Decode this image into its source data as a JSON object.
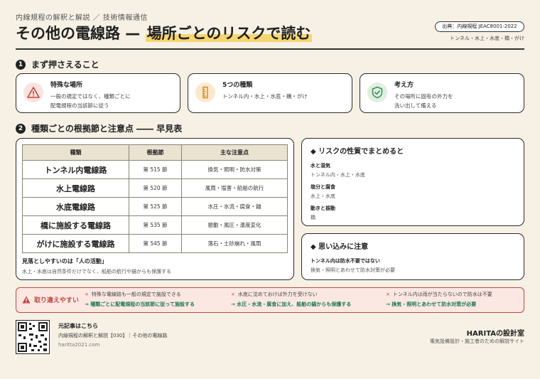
{
  "header": {
    "kicker": "内線規程の解釈と解説 ／ 技術情報通信",
    "title_main": "その他の電線路 — ",
    "title_highlight": "場所ごとのリスクで読む",
    "source": "出典：内線規程 JEAC8001-2022",
    "source_sub": "トンネル・水上・水底・橋・がけ"
  },
  "section1": {
    "num": "1",
    "title": "まず押さえること",
    "cards": [
      {
        "icon": "warning-icon",
        "title": "特殊な場所",
        "text": [
          "一般の規定ではなく、種類ごとに",
          "配電規程の当該節に従う"
        ]
      },
      {
        "icon": "ruler-icon",
        "title": "5つの種類",
        "text": [
          "トンネル内・水上・水底・橋・がけ"
        ]
      },
      {
        "icon": "shield-check-icon",
        "title": "考え方",
        "text": [
          "その場所に固有の外力を",
          "洗い出して備える"
        ]
      }
    ]
  },
  "section2": {
    "num": "2",
    "title": "種類ごとの根拠節と注意点 ―― 早見表",
    "table": {
      "headers": [
        "種類",
        "根拠節",
        "主な注意点"
      ],
      "rows": [
        {
          "place": "トンネル内電線路",
          "section": "第 515 節",
          "note": "換気・照明・防水対策"
        },
        {
          "place": "水上電線路",
          "section": "第 520 節",
          "note": "風雨・塩害・船舶の航行"
        },
        {
          "place": "水底電線路",
          "section": "第 525 節",
          "note": "水圧・水流・腐食・錨"
        },
        {
          "place": "橋に施設する電線路",
          "section": "第 535 節",
          "note": "振動・風圧・温度変化"
        },
        {
          "place": "がけに施設する電線路",
          "section": "第 545 節",
          "note": "落石・土砂崩れ・風雨"
        }
      ],
      "foot_title": "見落としやすいのは「人の活動」",
      "foot_text": "水上・水底は自然条件だけでなく、船舶の航行や錨からも保護する"
    }
  },
  "risk_panel": {
    "title": "リスクの性質でまとめると",
    "items": [
      {
        "k": "水と湿気",
        "v": "トンネル内・水上・水底"
      },
      {
        "k": "塩分と腐食",
        "v": "水上・水底"
      },
      {
        "k": "動きと振動",
        "v": "橋"
      }
    ]
  },
  "assume_panel": {
    "title": "思い込みに注意",
    "k": "トンネル内は防水不要ではない",
    "v": "換気・照明とあわせて防水対策が必要"
  },
  "mistakes": {
    "label": "取り違えやすい",
    "items": [
      {
        "wrong": "特殊な電線路も一般の規定で施設できる",
        "right": "→ 種類ごとに配電規程の当該節に従って施設する"
      },
      {
        "wrong": "水底に沈めておけば外力を受けない",
        "right": "→ 水圧・水流・腐食に加え、船舶の錨からも保護する"
      },
      {
        "wrong": "トンネル内は雨が当たらないので防水は不要",
        "right": "→ 換気・照明とあわせて防水対策が必要"
      }
    ]
  },
  "footer": {
    "qr_title": "元記事はこちら",
    "qr_sub": "内線規程の解釈と解説【030】｜その他の電線路",
    "url": "haritta2021.com",
    "brand": "HARITAの設計室",
    "brand_sub": "電気設備設計・施工者のための解説サイト"
  },
  "colors": {
    "accent": "#f6d66f",
    "warn": "#c0463d",
    "ok": "#1d7a4a",
    "amber": "#d98b1e",
    "green": "#3f8a5a"
  }
}
